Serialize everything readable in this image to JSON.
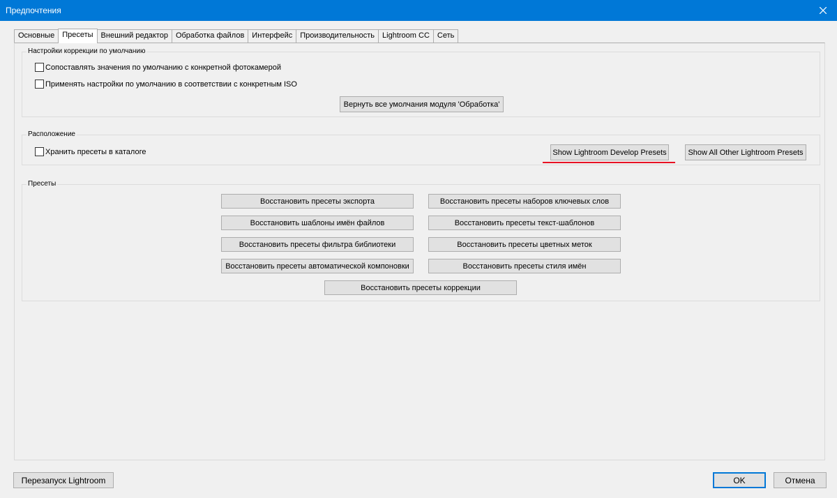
{
  "window": {
    "title": "Предпочтения",
    "close_icon": "close-icon"
  },
  "tabs": [
    {
      "label": "Основные",
      "active": false
    },
    {
      "label": "Пресеты",
      "active": true
    },
    {
      "label": "Внешний редактор",
      "active": false
    },
    {
      "label": "Обработка файлов",
      "active": false
    },
    {
      "label": "Интерфейс",
      "active": false
    },
    {
      "label": "Производительность",
      "active": false
    },
    {
      "label": "Lightroom CC",
      "active": false
    },
    {
      "label": "Сеть",
      "active": false
    }
  ],
  "defaults_group": {
    "label": "Настройки коррекции по умолчанию",
    "checkbox1": {
      "label": "Сопоставлять значения по умолчанию с конкретной фотокамерой",
      "checked": false
    },
    "checkbox2": {
      "label": "Применять настройки по умолчанию в соответствии с конкретным ISO",
      "checked": false
    },
    "reset_button": "Вернуть все умолчания модуля 'Обработка'"
  },
  "location_group": {
    "label": "Расположение",
    "store_checkbox": {
      "label": "Хранить пресеты в каталоге",
      "checked": false
    },
    "develop_presets_button": "Show Lightroom Develop Presets",
    "other_presets_button": "Show All Other Lightroom Presets",
    "highlight_color": "#e81123"
  },
  "presets_group": {
    "label": "Пресеты",
    "left_buttons": [
      "Восстановить пресеты экспорта",
      "Восстановить шаблоны имён файлов",
      "Восстановить пресеты фильтра библиотеки",
      "Восстановить пресеты автоматической компоновки"
    ],
    "right_buttons": [
      "Восстановить пресеты наборов ключевых слов",
      "Восстановить пресеты текст-шаблонов",
      "Восстановить пресеты цветных меток",
      "Восстановить пресеты стиля имён"
    ],
    "bottom_button": "Восстановить пресеты коррекции"
  },
  "footer": {
    "restart_button": "Перезапуск Lightroom",
    "ok_button": "OK",
    "cancel_button": "Отмена"
  },
  "colors": {
    "titlebar": "#0078d7",
    "accent": "#0078d7"
  }
}
